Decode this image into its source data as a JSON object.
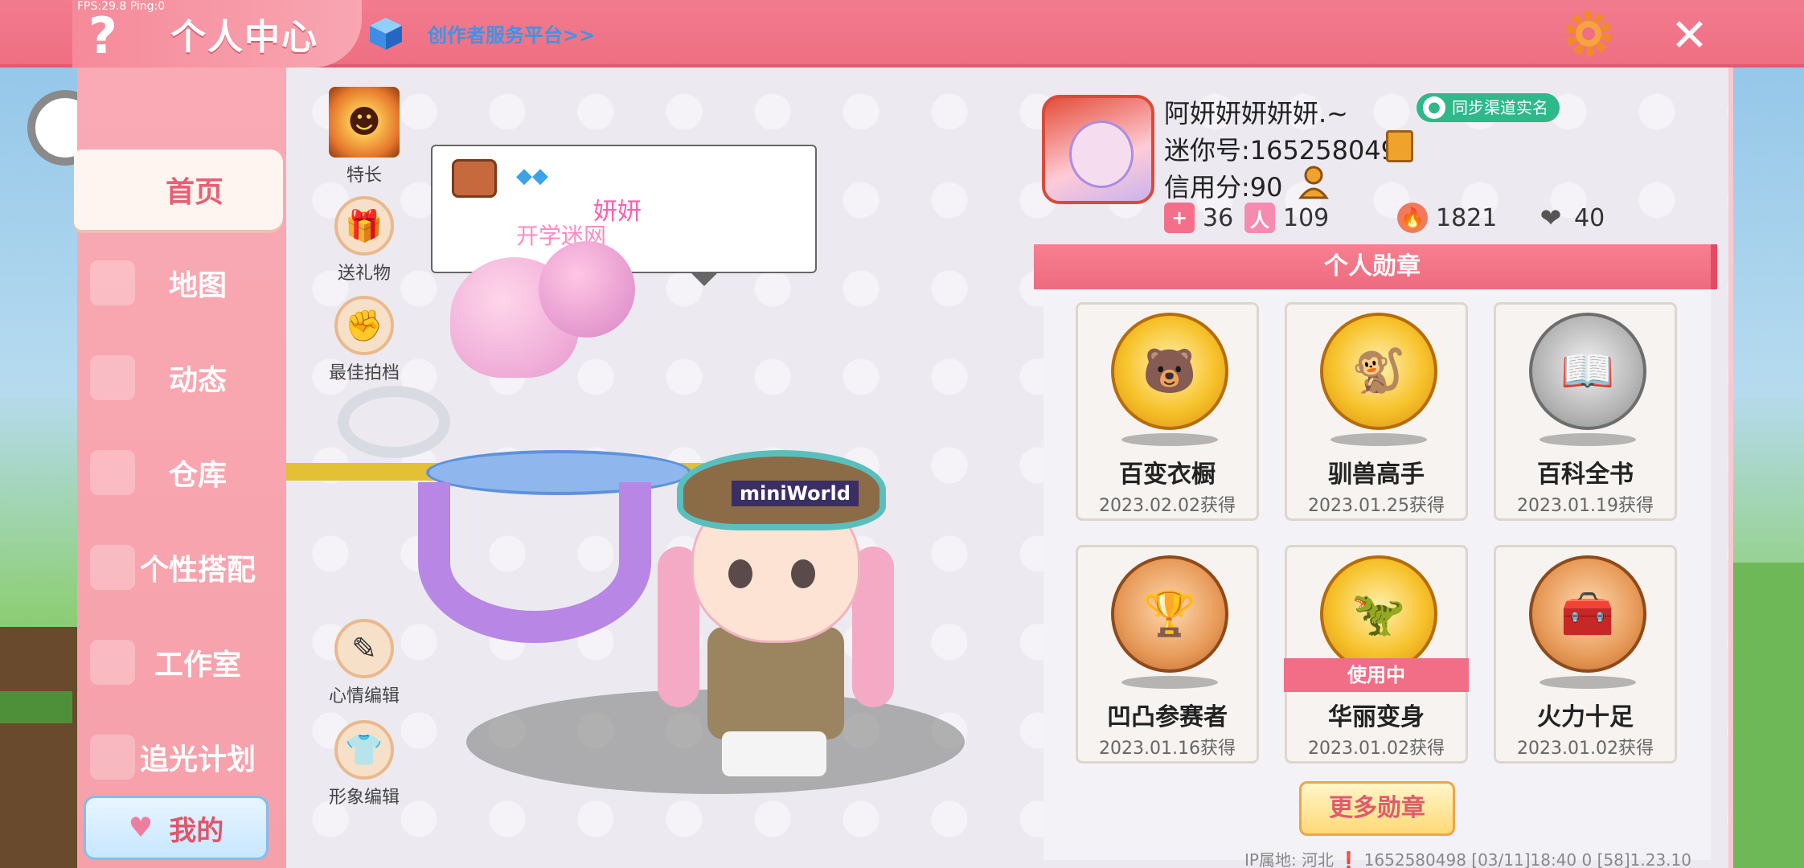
{
  "header": {
    "fps": "FPS:29.8  Ping:0",
    "help": "?",
    "title": "个人中心",
    "creator_link": "创作者服务平台>>",
    "close": "✕"
  },
  "sidebar": {
    "items": [
      {
        "label": "首页",
        "active": true
      },
      {
        "label": "地图"
      },
      {
        "label": "动态"
      },
      {
        "label": "仓库"
      },
      {
        "label": "个性搭配"
      },
      {
        "label": "工作室"
      },
      {
        "label": "追光计划"
      }
    ],
    "mine": "我的"
  },
  "actions": {
    "skill": "特长",
    "gift": "送礼物",
    "best_save": "最佳拍档",
    "mood_edit": "心情编辑",
    "image_edit": "形象编辑"
  },
  "bubble": {
    "name": "妍妍",
    "subtitle": "开学迷网"
  },
  "character": {
    "hat_label": "miniWorld"
  },
  "profile": {
    "name": "阿妍妍妍妍妍.~",
    "verify": "同步渠道实名",
    "mini_id": "迷你号:1652580498",
    "credit": "信用分:90",
    "stats": [
      {
        "icon": "plus-flag-icon",
        "value": "36",
        "color": "#f36f8a"
      },
      {
        "icon": "cheer-icon",
        "value": "109",
        "color": "#f58cb0"
      },
      {
        "icon": "flame-icon",
        "value": "1821",
        "color": "#f27a5a"
      },
      {
        "icon": "hearts-icon",
        "value": "40",
        "color": "#555555"
      }
    ]
  },
  "medals": {
    "header": "个人勋章",
    "items": [
      {
        "name": "百变衣橱",
        "date": "2023.02.02获得",
        "style": "gold",
        "icon": "bear-icon"
      },
      {
        "name": "驯兽高手",
        "date": "2023.01.25获得",
        "style": "gold",
        "icon": "monkey-icon"
      },
      {
        "name": "百科全书",
        "date": "2023.01.19获得",
        "style": "silver",
        "icon": "book-icon"
      },
      {
        "name": "凹凸参赛者",
        "date": "2023.01.16获得",
        "style": "bronze",
        "icon": "trophy-icon"
      },
      {
        "name": "华丽变身",
        "date": "2023.01.02获得",
        "style": "gold",
        "icon": "dino-icon",
        "badge": "使用中"
      },
      {
        "name": "火力十足",
        "date": "2023.01.02获得",
        "style": "bronze",
        "icon": "chest-icon"
      }
    ],
    "more": "更多勋章"
  },
  "footer": {
    "text": "IP属地: 河北 ❗   1652580498   [03/11]18:40 0  [58]1.23.10"
  }
}
